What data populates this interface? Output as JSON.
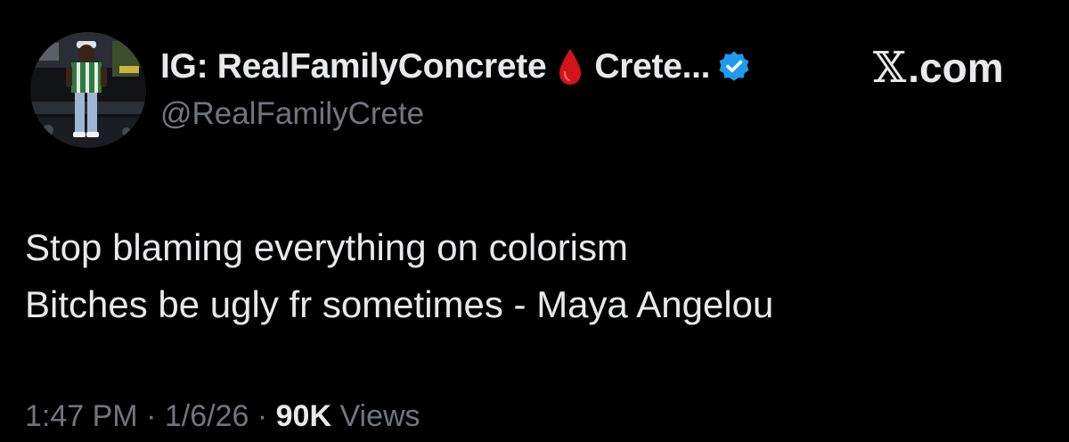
{
  "author": {
    "display_name": "IG: RealFamilyConcrete",
    "name_suffix": "Crete...",
    "handle": "@RealFamilyCrete",
    "emoji_icon": "drop-of-blood-icon",
    "verified_icon": "verified-badge-icon",
    "verified_color": "#1d9bf0"
  },
  "brand": {
    "x_glyph": "𝕏",
    "domain": ".com"
  },
  "tweet": {
    "lines": [
      "Stop blaming everything on colorism",
      "Bitches be ugly fr sometimes - Maya Angelou"
    ]
  },
  "meta": {
    "time": "1:47 PM",
    "separator": "·",
    "date": "1/6/26",
    "views_count": "90K",
    "views_label": "Views"
  },
  "colors": {
    "background": "#000000",
    "primary_text": "#e7e9ea",
    "secondary_text": "#71767b",
    "blood_red": "#d4141c"
  }
}
